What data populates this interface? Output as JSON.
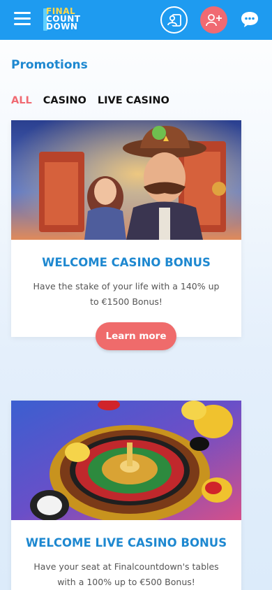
{
  "header": {
    "menu_icon": "hamburger-menu-icon",
    "logo": {
      "line1": "FINAL",
      "line2": "COUNT",
      "line3": "DOWN"
    },
    "login_icon": "user-login-icon",
    "register_icon": "user-add-icon",
    "chat_icon": "chat-bubble-icon",
    "colors": {
      "bar": "#1e9bf0",
      "register": "#f06a72"
    }
  },
  "page": {
    "title": "Promotions",
    "tabs": [
      {
        "label": "ALL",
        "active": true
      },
      {
        "label": "CASINO",
        "active": false
      },
      {
        "label": "LIVE CASINO",
        "active": false
      }
    ]
  },
  "promotions": [
    {
      "title": "WELCOME CASINO BONUS",
      "description": "Have the stake of your life with a 140% up to €1500 Bonus!",
      "button": "Learn more"
    },
    {
      "title": "WELCOME LIVE CASINO BONUS",
      "description": "Have your seat at Finalcountdown's tables with a 100% up to €500 Bonus!"
    }
  ],
  "colors": {
    "accent": "#1e88d0",
    "button": "#ef6b6b",
    "active_tab": "#f06a72"
  }
}
